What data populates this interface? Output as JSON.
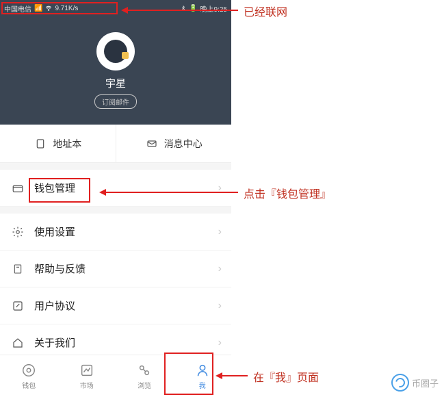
{
  "status": {
    "carrier": "中国电信",
    "speed": "9.71K/s",
    "time": "晚上9:25"
  },
  "profile": {
    "username": "宇星",
    "subscribe": "订阅邮件"
  },
  "quick": {
    "address_book": "地址本",
    "message_center": "消息中心"
  },
  "menu": {
    "wallet_manage": "钱包管理",
    "settings": "使用设置",
    "help_feedback": "帮助与反馈",
    "user_agreement": "用户协议",
    "about_us": "关于我们"
  },
  "nav": {
    "wallet": "钱包",
    "market": "市场",
    "browse": "浏览",
    "me": "我"
  },
  "annotations": {
    "connected": "已经联网",
    "click_wallet": "点击『钱包管理』",
    "on_me_page": "在『我』页面"
  },
  "watermark": "币圈子"
}
